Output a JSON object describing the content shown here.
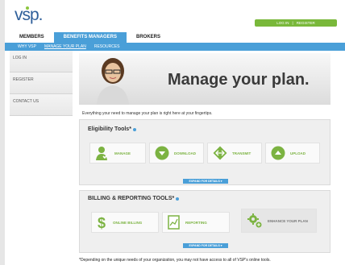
{
  "header": {
    "logo_text": "vsp.",
    "login_label": "LOG IN",
    "separator": "|",
    "register_label": "REGISTER"
  },
  "tabs": [
    {
      "label": "MEMBERS"
    },
    {
      "label": "BENEFITS MANAGERS"
    },
    {
      "label": "BROKERS"
    }
  ],
  "subnav": [
    {
      "label": "WHY VSP"
    },
    {
      "label": "MANAGE YOUR PLAN"
    },
    {
      "label": "RESOURCES"
    }
  ],
  "sidebar": [
    {
      "label": "LOG IN"
    },
    {
      "label": "REGISTER"
    },
    {
      "label": "CONTACT US"
    }
  ],
  "hero": {
    "title": "Manage your plan."
  },
  "intro": "Everything your need to manage your plan is right here at your fingertips.",
  "eligibility": {
    "title": "Eligibility Tools",
    "title_suffix": "*",
    "tools": [
      {
        "label": "MANAGE",
        "icon": "person-check-icon"
      },
      {
        "label": "DOWNLOAD",
        "icon": "download-icon"
      },
      {
        "label": "TRANSMIT",
        "icon": "transmit-icon"
      },
      {
        "label": "UPLOAD",
        "icon": "upload-icon"
      }
    ],
    "expand_label": "EXPAND FOR DETAILS ▾"
  },
  "billing": {
    "title": "BILLING & REPORTING TOOLS",
    "title_suffix": "*",
    "tools": [
      {
        "label": "ONLINE BILLING",
        "icon": "dollar-icon"
      },
      {
        "label": "REPORTING",
        "icon": "report-icon"
      },
      {
        "label": "ENHANCE YOUR PLAN",
        "icon": "gear-plus-icon"
      }
    ],
    "expand_label": "EXPAND FOR DETAILS ▾"
  },
  "footnote": "*Depending on the unique needs of your organization, you may not have access to all of VSP's online tools.",
  "colors": {
    "accent_blue": "#4a9fd8",
    "accent_green": "#7cb342",
    "login_green": "#79b83a"
  }
}
